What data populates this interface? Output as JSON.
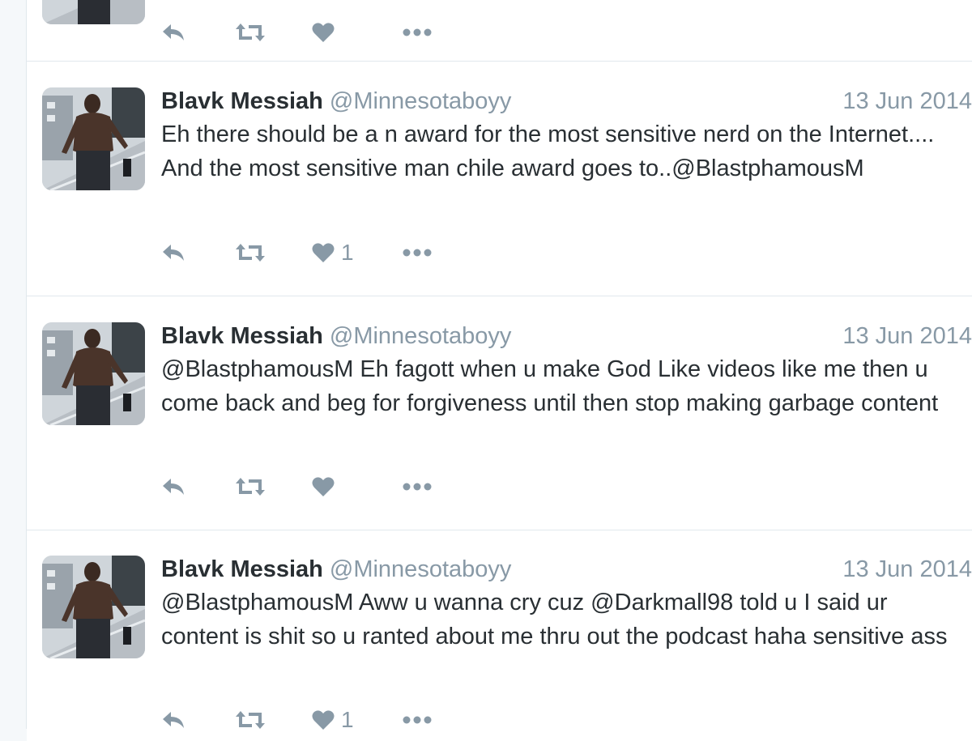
{
  "colors": {
    "text": "#292f33",
    "muted": "#8899a6",
    "icon": "#8899a6",
    "divider": "#e1e8ed",
    "background": "#ffffff"
  },
  "icons": {
    "reply": "reply-icon",
    "retweet": "retweet-icon",
    "like": "heart-icon",
    "more": "more-dots-icon"
  },
  "tweets": [
    {
      "display_name": "",
      "handle": "",
      "date": "",
      "text": "",
      "like_count": ""
    },
    {
      "display_name": "Blavk Messiah",
      "handle": "@Minnesotaboyy",
      "date": "13 Jun 2014",
      "text": "Eh there should be a n award for the most sensitive nerd on the Internet.... And the most sensitive man chile award goes to..@BlastphamousM",
      "like_count": "1"
    },
    {
      "display_name": "Blavk Messiah",
      "handle": "@Minnesotaboyy",
      "date": "13 Jun 2014",
      "text": "@BlastphamousM Eh fagott when u make God Like videos like me then u come back and beg for forgiveness until then stop making garbage content",
      "like_count": ""
    },
    {
      "display_name": "Blavk Messiah",
      "handle": "@Minnesotaboyy",
      "date": "13 Jun 2014",
      "text": "@BlastphamousM Aww u wanna cry cuz @Darkmall98 told u I said ur content is shit so u ranted about me thru out the podcast haha sensitive ass",
      "like_count": "1"
    }
  ]
}
